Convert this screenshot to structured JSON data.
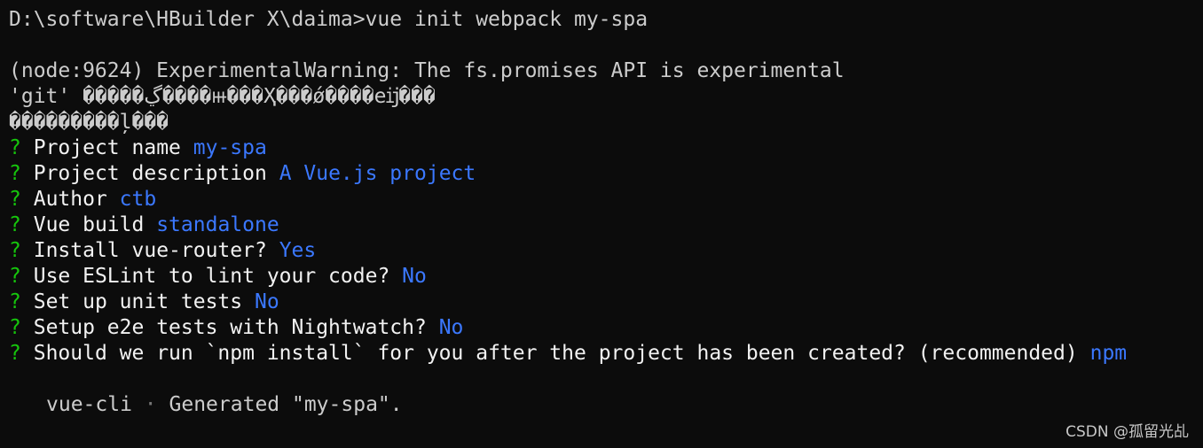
{
  "terminal": {
    "command_line": "D:\\software\\HBuilder X\\daima>vue init webpack my-spa",
    "warning_line": "(node:9624) ExperimentalWarning: The fs.promises API is experimental",
    "garbled_line_1": "'git' �����ڲ����ⲿ���Ҳ���ǿ����еĳ���",
    "garbled_line_2": "���������ļ���",
    "prompt_mark": "?",
    "questions": [
      {
        "label": "Project name",
        "answer": "my-spa"
      },
      {
        "label": "Project description",
        "answer": "A Vue.js project"
      },
      {
        "label": "Author",
        "answer": "ctb"
      },
      {
        "label": "Vue build",
        "answer": "standalone"
      },
      {
        "label": "Install vue-router?",
        "answer": "Yes"
      },
      {
        "label": "Use ESLint to lint your code?",
        "answer": "No"
      },
      {
        "label": "Set up unit tests",
        "answer": "No"
      },
      {
        "label": "Setup e2e tests with Nightwatch?",
        "answer": "No"
      },
      {
        "label": "Should we run `npm install` for you after the project has been created? (recommended)",
        "answer": "npm"
      }
    ],
    "result": {
      "tool": "vue-cli",
      "separator": "·",
      "message": "Generated \"my-spa\"."
    }
  },
  "watermark": "CSDN @孤留光乩",
  "colors": {
    "background": "#0c0c0c",
    "prompt_mark": "#16c60c",
    "answer": "#3b78ff",
    "text": "#cccccc"
  }
}
